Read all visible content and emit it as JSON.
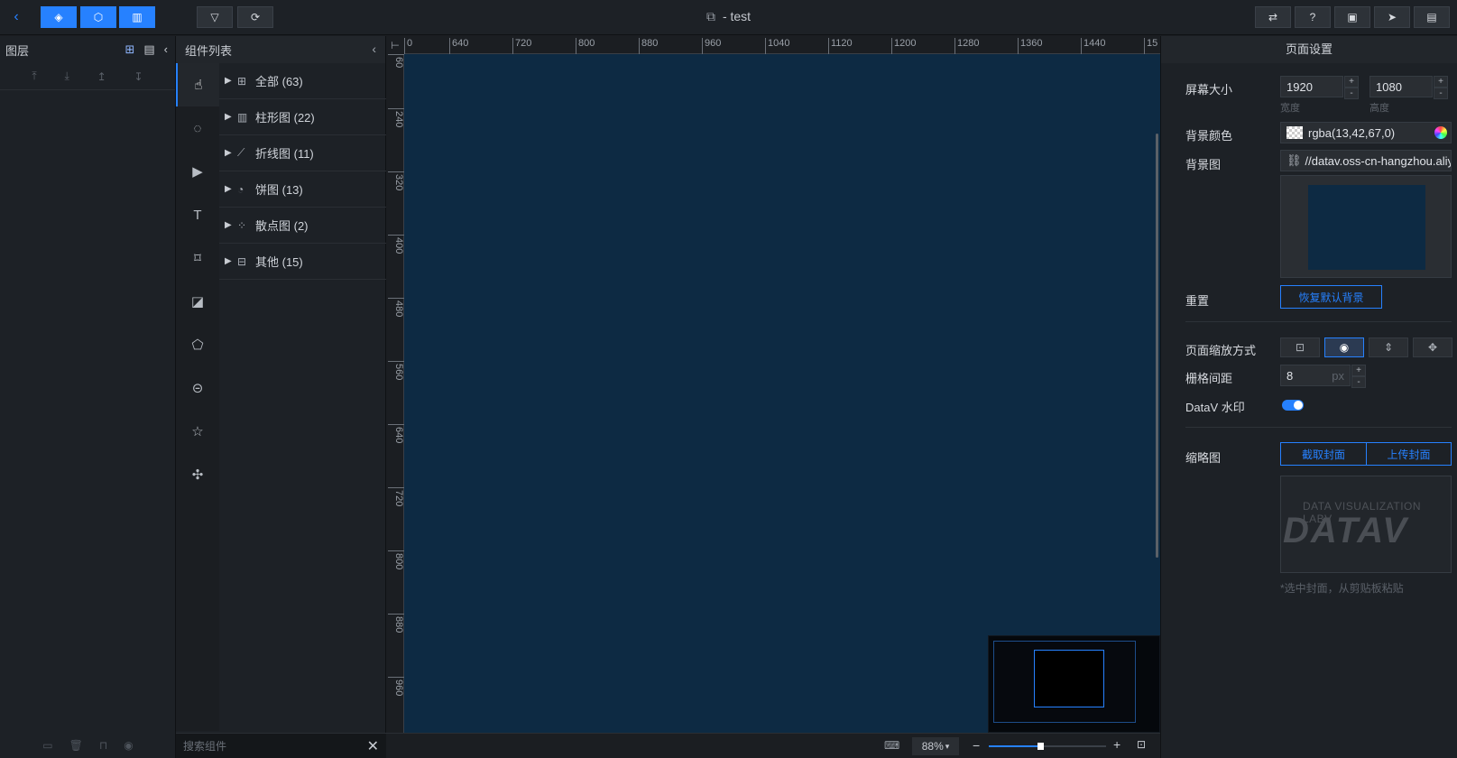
{
  "topbar": {
    "title": "- test",
    "back_icon": "chevron-left-icon"
  },
  "layers": {
    "title": "图层"
  },
  "components": {
    "title": "组件列表",
    "categories": [
      {
        "label": "全部 (63)",
        "icon": "grid-icon"
      },
      {
        "label": "柱形图 (22)",
        "icon": "bar-chart-icon"
      },
      {
        "label": "折线图 (11)",
        "icon": "line-chart-icon"
      },
      {
        "label": "饼图 (13)",
        "icon": "pie-chart-icon"
      },
      {
        "label": "散点图 (2)",
        "icon": "scatter-chart-icon"
      },
      {
        "label": "其他 (15)",
        "icon": "other-icon"
      }
    ],
    "search_placeholder": "搜索组件"
  },
  "ruler": {
    "h_ticks": [
      "0",
      "640",
      "720",
      "800",
      "880",
      "960",
      "1040",
      "1120",
      "1200",
      "1280",
      "1360",
      "1440",
      "15"
    ],
    "v_ticks": [
      "60",
      "240",
      "320",
      "400",
      "480",
      "560",
      "640",
      "720",
      "800",
      "880",
      "960"
    ]
  },
  "canvas": {
    "background": "#0d2a43",
    "zoom": "88%",
    "zoom_level": 0.44
  },
  "settings": {
    "title": "页面设置",
    "screen_size_label": "屏幕大小",
    "width_value": "1920",
    "height_value": "1080",
    "width_sub": "宽度",
    "height_sub": "高度",
    "bg_color_label": "背景颜色",
    "bg_color_value": "rgba(13,42,67,0)",
    "bg_image_label": "背景图",
    "bg_image_value": "//datav.oss-cn-hangzhou.aliyun",
    "reset_label": "重置",
    "reset_button": "恢复默认背景",
    "zoom_mode_label": "页面缩放方式",
    "grid_label": "栅格间距",
    "grid_value": "8",
    "grid_unit": "px",
    "watermark_label": "DataV 水印",
    "thumbnail_label": "缩略图",
    "capture_button": "截取封面",
    "upload_button": "上传封面",
    "thumb_text_small": "DATA VISUALIZATION LABV",
    "thumb_text_big": "DATAV",
    "hint": "*选中封面，从剪贴板粘贴"
  }
}
